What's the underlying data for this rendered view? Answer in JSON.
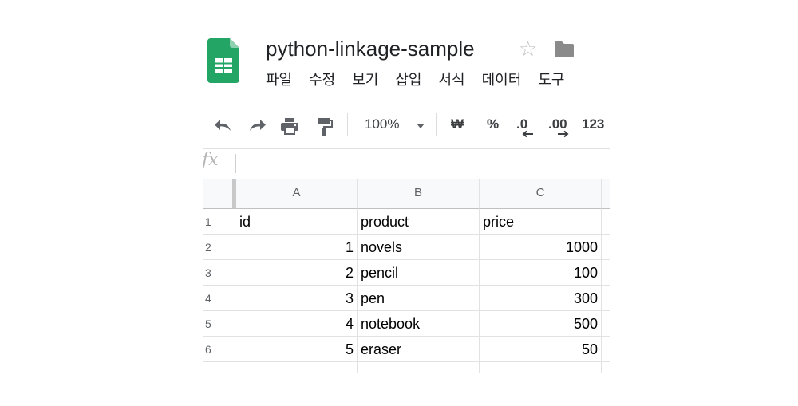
{
  "header": {
    "doc_title": "python-linkage-sample",
    "logo_icon": "google-sheets-logo-icon",
    "star_icon": "star-outline-icon",
    "folder_icon": "folder-icon",
    "menu": [
      "파일",
      "수정",
      "보기",
      "삽입",
      "서식",
      "데이터",
      "도구"
    ]
  },
  "toolbar": {
    "undo_icon": "undo-icon",
    "redo_icon": "redo-icon",
    "print_icon": "print-icon",
    "paint_format_icon": "paint-format-icon",
    "zoom": "100%",
    "currency": "₩",
    "percent": "%",
    "decrease_decimal": ".0",
    "increase_decimal": ".00",
    "more_formats": "123"
  },
  "formula_bar": {
    "fx_label": "fx",
    "value": ""
  },
  "grid": {
    "columns": [
      "A",
      "B",
      "C"
    ],
    "row_numbers": [
      "1",
      "2",
      "3",
      "4",
      "5",
      "6"
    ],
    "rows": [
      [
        "id",
        "product",
        "price"
      ],
      [
        "1",
        "novels",
        "1000"
      ],
      [
        "2",
        "pencil",
        "100"
      ],
      [
        "3",
        "pen",
        "300"
      ],
      [
        "4",
        "notebook",
        "500"
      ],
      [
        "5",
        "eraser",
        "50"
      ]
    ]
  },
  "colors": {
    "sheets_green": "#23A566",
    "sheets_green_dark": "#188038",
    "icon_gray": "#5f6368",
    "grid_line": "#e2e2e2",
    "header_bg": "#f8f9fa"
  }
}
